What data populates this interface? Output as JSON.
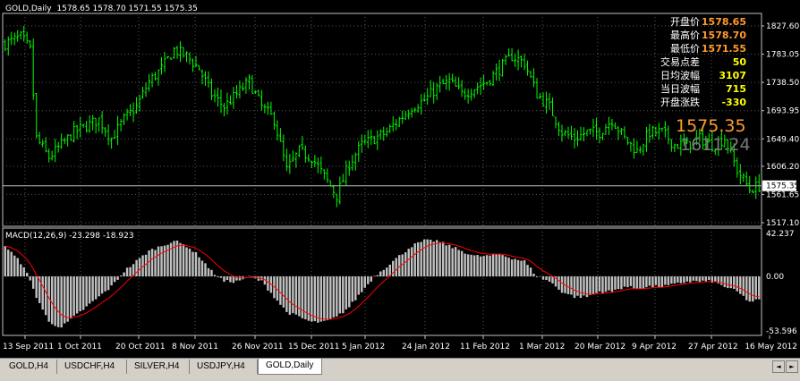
{
  "header": {
    "symbol": "GOLD,Daily",
    "ohlc": "1578.65 1578.70 1571.55 1575.35"
  },
  "info_panel": [
    {
      "label": "开盘价",
      "value": "1578.65",
      "color": "orange"
    },
    {
      "label": "最高价",
      "value": "1578.70",
      "color": "orange"
    },
    {
      "label": "最低价",
      "value": "1571.55",
      "color": "orange"
    },
    {
      "label": "交易点差",
      "value": "50",
      "color": "yellow"
    },
    {
      "label": "日均波幅",
      "value": "3107",
      "color": "yellow"
    },
    {
      "label": "当日波幅",
      "value": "715",
      "color": "yellow"
    },
    {
      "label": "开盘涨跌",
      "value": "-330",
      "color": "yellow"
    }
  ],
  "big_price": "1575.35",
  "big_price_secondary": "1611.24",
  "price_axis": [
    "1827.60",
    "1783.05",
    "1738.50",
    "1693.95",
    "1649.40",
    "1606.20",
    "1575.35",
    "1561.65",
    "1517.10"
  ],
  "macd": {
    "label": "MACD(12,26,9) -23.298 -18.923",
    "axis": [
      "42.237",
      "0.00",
      "-53.596"
    ]
  },
  "date_axis": [
    "13 Sep 2011",
    "1 Oct 2011",
    "20 Oct 2011",
    "8 Nov 2011",
    "26 Nov 2011",
    "15 Dec 2011",
    "5 Jan 2012",
    "24 Jan 2012",
    "11 Feb 2012",
    "1 Mar 2012",
    "20 Mar 2012",
    "9 Apr 2012",
    "27 Apr 2012",
    "16 May 2012"
  ],
  "tabs": [
    {
      "label": "GOLD,H4",
      "active": false
    },
    {
      "label": "USDCHF,H4",
      "active": false
    },
    {
      "label": "SILVER,H4",
      "active": false
    },
    {
      "label": "USDJPY,H4",
      "active": false
    },
    {
      "label": "GOLD,Daily",
      "active": true
    }
  ],
  "chart_data": {
    "type": "bar",
    "price_range": [
      1517.1,
      1850
    ],
    "macd_range": [
      -53.596,
      42.237
    ],
    "close_anchors": [
      [
        0,
        1800
      ],
      [
        5,
        1810
      ],
      [
        8,
        1790
      ],
      [
        10,
        1650
      ],
      [
        14,
        1620
      ],
      [
        18,
        1640
      ],
      [
        22,
        1660
      ],
      [
        26,
        1670
      ],
      [
        30,
        1680
      ],
      [
        34,
        1650
      ],
      [
        38,
        1680
      ],
      [
        42,
        1700
      ],
      [
        46,
        1740
      ],
      [
        50,
        1760
      ],
      [
        54,
        1790
      ],
      [
        58,
        1780
      ],
      [
        62,
        1760
      ],
      [
        66,
        1720
      ],
      [
        70,
        1700
      ],
      [
        74,
        1720
      ],
      [
        78,
        1740
      ],
      [
        82,
        1700
      ],
      [
        86,
        1680
      ],
      [
        90,
        1600
      ],
      [
        94,
        1630
      ],
      [
        98,
        1620
      ],
      [
        102,
        1590
      ],
      [
        106,
        1560
      ],
      [
        110,
        1610
      ],
      [
        114,
        1640
      ],
      [
        118,
        1650
      ],
      [
        122,
        1660
      ],
      [
        126,
        1680
      ],
      [
        130,
        1700
      ],
      [
        134,
        1710
      ],
      [
        138,
        1730
      ],
      [
        142,
        1740
      ],
      [
        146,
        1720
      ],
      [
        150,
        1730
      ],
      [
        154,
        1740
      ],
      [
        158,
        1760
      ],
      [
        162,
        1780
      ],
      [
        166,
        1770
      ],
      [
        170,
        1720
      ],
      [
        174,
        1700
      ],
      [
        178,
        1660
      ],
      [
        182,
        1650
      ],
      [
        186,
        1660
      ],
      [
        190,
        1660
      ],
      [
        194,
        1680
      ],
      [
        198,
        1650
      ],
      [
        202,
        1630
      ],
      [
        206,
        1660
      ],
      [
        210,
        1660
      ],
      [
        214,
        1640
      ],
      [
        218,
        1640
      ],
      [
        222,
        1650
      ],
      [
        226,
        1640
      ],
      [
        230,
        1650
      ],
      [
        234,
        1600
      ],
      [
        238,
        1570
      ],
      [
        241,
        1575
      ]
    ],
    "macd_anchors": [
      [
        0,
        30
      ],
      [
        6,
        10
      ],
      [
        10,
        -20
      ],
      [
        14,
        -45
      ],
      [
        18,
        -50
      ],
      [
        22,
        -40
      ],
      [
        26,
        -30
      ],
      [
        30,
        -20
      ],
      [
        34,
        -10
      ],
      [
        38,
        5
      ],
      [
        42,
        15
      ],
      [
        46,
        25
      ],
      [
        50,
        30
      ],
      [
        54,
        35
      ],
      [
        58,
        30
      ],
      [
        62,
        20
      ],
      [
        66,
        5
      ],
      [
        70,
        -5
      ],
      [
        74,
        -5
      ],
      [
        78,
        0
      ],
      [
        82,
        -5
      ],
      [
        86,
        -20
      ],
      [
        90,
        -35
      ],
      [
        94,
        -40
      ],
      [
        98,
        -45
      ],
      [
        102,
        -45
      ],
      [
        106,
        -40
      ],
      [
        110,
        -30
      ],
      [
        114,
        -15
      ],
      [
        118,
        0
      ],
      [
        122,
        10
      ],
      [
        126,
        20
      ],
      [
        130,
        30
      ],
      [
        134,
        35
      ],
      [
        138,
        35
      ],
      [
        142,
        30
      ],
      [
        146,
        25
      ],
      [
        150,
        20
      ],
      [
        154,
        20
      ],
      [
        158,
        22
      ],
      [
        162,
        18
      ],
      [
        166,
        15
      ],
      [
        170,
        0
      ],
      [
        174,
        -5
      ],
      [
        178,
        -15
      ],
      [
        182,
        -20
      ],
      [
        186,
        -20
      ],
      [
        190,
        -15
      ],
      [
        194,
        -15
      ],
      [
        198,
        -10
      ],
      [
        202,
        -12
      ],
      [
        206,
        -10
      ],
      [
        210,
        -10
      ],
      [
        214,
        -8
      ],
      [
        218,
        -5
      ],
      [
        222,
        -5
      ],
      [
        226,
        -5
      ],
      [
        230,
        -10
      ],
      [
        234,
        -15
      ],
      [
        238,
        -25
      ],
      [
        241,
        -23
      ]
    ],
    "colors": {
      "candles": "#00ff00",
      "histogram": "#c0c0c0",
      "signal": "#ff0000",
      "grid": "#c0c0c0"
    }
  }
}
